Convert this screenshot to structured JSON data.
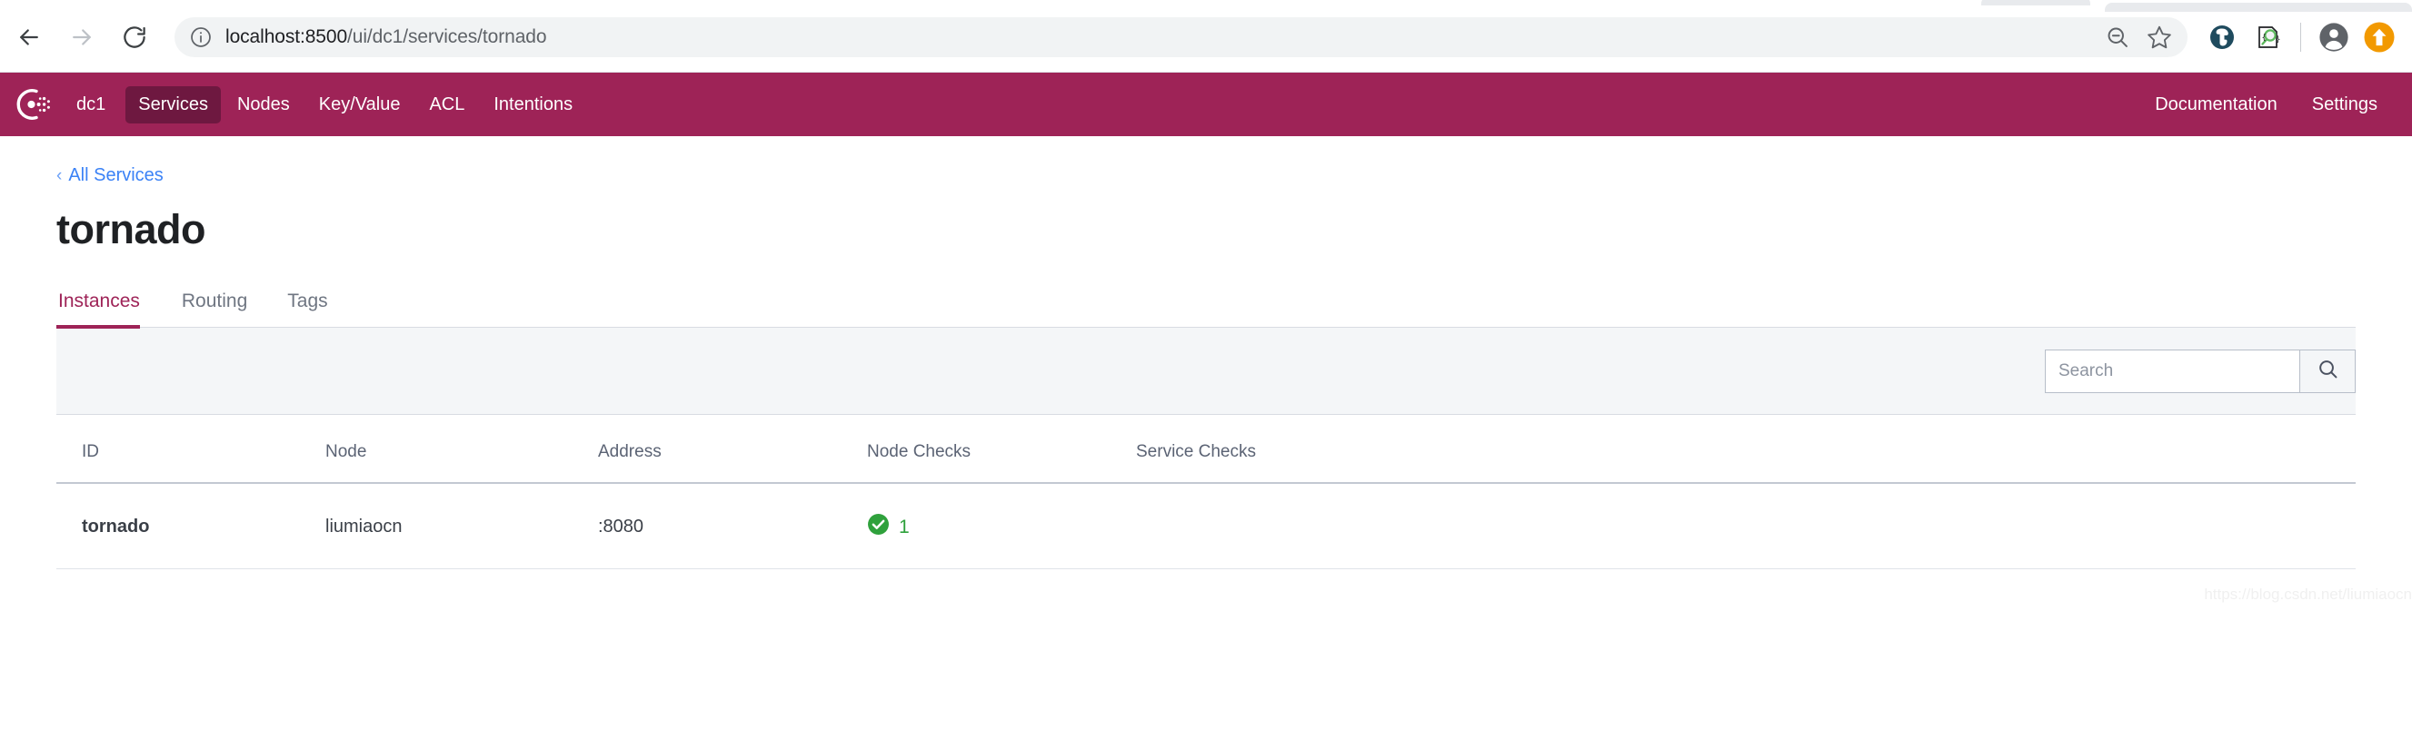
{
  "browser": {
    "url_host": "localhost:8500",
    "url_path": "/ui/dc1/services/tornado",
    "back_icon": "back-arrow-icon",
    "forward_icon": "forward-arrow-icon",
    "reload_icon": "reload-icon",
    "info_icon": "site-info-icon",
    "zoom_out_icon": "zoom-out-icon",
    "bookmark_icon": "star-icon",
    "extension_1_icon": "evernote-extension-icon",
    "extension_2_icon": "inspector-extension-icon",
    "profile_icon": "profile-avatar-icon",
    "update_icon": "update-arrow-icon"
  },
  "nav": {
    "brand_icon": "consul-logo-icon",
    "datacenter": "dc1",
    "items": [
      {
        "label": "Services",
        "active": true
      },
      {
        "label": "Nodes",
        "active": false
      },
      {
        "label": "Key/Value",
        "active": false
      },
      {
        "label": "ACL",
        "active": false
      },
      {
        "label": "Intentions",
        "active": false
      }
    ],
    "right_items": [
      {
        "label": "Documentation"
      },
      {
        "label": "Settings"
      }
    ]
  },
  "breadcrumb": {
    "chevron": "‹",
    "label": "All Services"
  },
  "page": {
    "title": "tornado"
  },
  "tabs": [
    {
      "label": "Instances",
      "active": true
    },
    {
      "label": "Routing",
      "active": false
    },
    {
      "label": "Tags",
      "active": false
    }
  ],
  "search": {
    "value": "",
    "placeholder": "Search",
    "button_icon": "search-icon"
  },
  "table": {
    "columns": [
      "ID",
      "Node",
      "Address",
      "Node Checks",
      "Service Checks"
    ],
    "rows": [
      {
        "id": "tornado",
        "node": "liumiaocn",
        "address": ":8080",
        "node_checks_count": "1",
        "node_checks_status": "passing",
        "service_checks_count": ""
      }
    ]
  },
  "colors": {
    "brand": "#9e2357",
    "brand_active": "#6e1840",
    "link": "#3b82f6",
    "status_passing": "#2fa13c"
  },
  "watermark": "https://blog.csdn.net/liumiaocn"
}
